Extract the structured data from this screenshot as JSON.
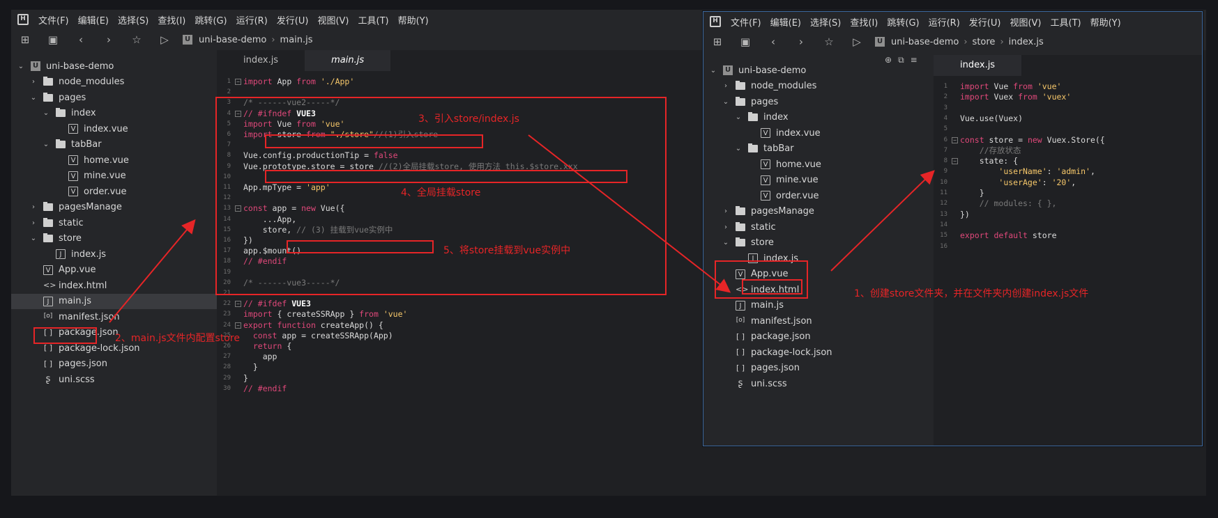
{
  "menus": [
    "文件(F)",
    "编辑(E)",
    "选择(S)",
    "查找(I)",
    "跳转(G)",
    "运行(R)",
    "发行(U)",
    "视图(V)",
    "工具(T)",
    "帮助(Y)"
  ],
  "left": {
    "breadcrumb": [
      "uni-base-demo",
      "main.js"
    ],
    "tabs": [
      "index.js",
      "main.js"
    ],
    "tree": [
      "uni-base-demo",
      "node_modules",
      "pages",
      "index",
      "index.vue",
      "tabBar",
      "home.vue",
      "mine.vue",
      "order.vue",
      "pagesManage",
      "static",
      "store",
      "index.js",
      "App.vue",
      "index.html",
      "main.js",
      "manifest.json",
      "package.json",
      "package-lock.json",
      "pages.json",
      "uni.scss"
    ],
    "code": [
      "import App from './App'",
      "",
      "/* ------vue2-----*/",
      "// #ifndef VUE3",
      "import Vue from 'vue'",
      "import store from \"./store\"//(1)引入store",
      "",
      "Vue.config.productionTip = false",
      "Vue.prototype.store = store //(2)全局挂载store, 使用方法 this.$store.xxx",
      "",
      "App.mpType = 'app'",
      "",
      "const app = new Vue({",
      "    ...App,",
      "    store, // (3) 挂载到vue实例中",
      "})",
      "app.$mount()",
      "// #endif",
      "",
      "/* ------vue3-----*/",
      "",
      "// #ifdef VUE3",
      "import { createSSRApp } from 'vue'",
      "export function createApp() {",
      "  const app = createSSRApp(App)",
      "  return {",
      "    app",
      "  }",
      "}",
      "// #endif"
    ]
  },
  "right": {
    "breadcrumb": [
      "uni-base-demo",
      "store",
      "index.js"
    ],
    "tabs": [
      "index.js"
    ],
    "tree": [
      "uni-base-demo",
      "node_modules",
      "pages",
      "index",
      "index.vue",
      "tabBar",
      "home.vue",
      "mine.vue",
      "order.vue",
      "pagesManage",
      "static",
      "store",
      "index.js",
      "App.vue",
      "index.html",
      "main.js",
      "manifest.json",
      "package.json",
      "package-lock.json",
      "pages.json",
      "uni.scss"
    ],
    "code": [
      "import Vue from 'vue'",
      "import Vuex from 'vuex'",
      "",
      "Vue.use(Vuex)",
      "",
      "const store = new Vuex.Store({",
      "    //存放状态",
      "    state: {",
      "        'userName': 'admin',",
      "        'userAge': '20',",
      "    }",
      "    // modules: { },",
      "})",
      "",
      "export default store",
      ""
    ]
  },
  "annotations": {
    "a1": "1、创建store文件夹，并在文件夹内创建index.js文件",
    "a2": "2、main.js文件内配置store",
    "a3": "3、引入store/index.js",
    "a4": "4、全局挂载store",
    "a5": "5、将store挂载到vue实例中"
  },
  "colors": {
    "annotation": "#e62527",
    "keyword": "#e0487a",
    "string": "#f7c86a",
    "comment": "#7a7a7a",
    "frame": "#3e6aa0"
  }
}
